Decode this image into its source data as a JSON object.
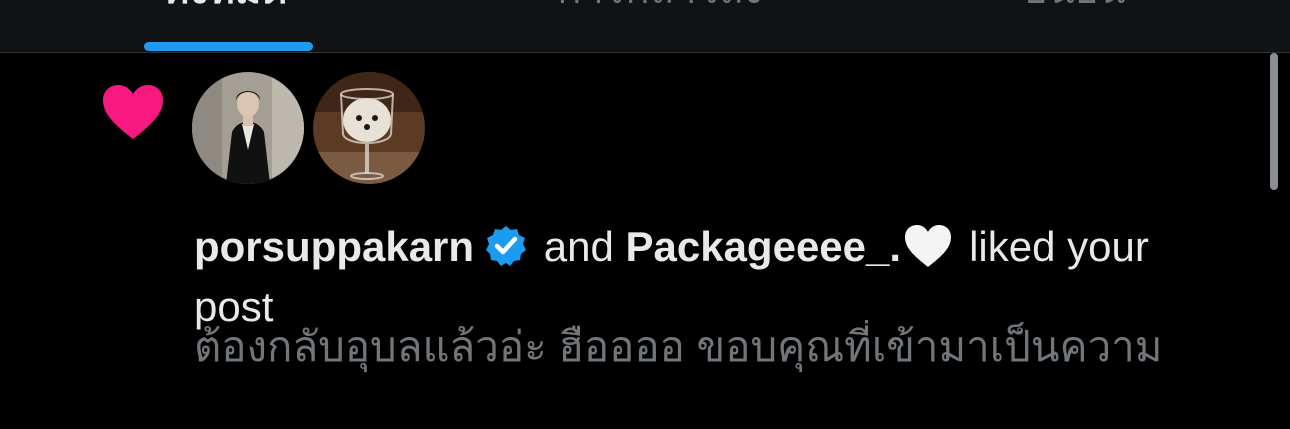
{
  "tabs": [
    {
      "label": "ทั้งหมด",
      "active": true
    },
    {
      "label": "การกล่าวถึง",
      "active": false
    },
    {
      "label": "ยืนยัน",
      "active": false
    }
  ],
  "notification": {
    "type_icon": "heart-icon",
    "type_color": "#f91880",
    "avatars": [
      {
        "user": "porsuppakarn",
        "icon": "avatar-person-in-suit"
      },
      {
        "user": "Packageeee_.",
        "icon": "avatar-dog-in-wine-glass"
      }
    ],
    "actor_1": "porsuppakarn",
    "verified_icon": "verified-badge-icon",
    "verified_color": "#1d9bf0",
    "connector": "and",
    "actor_2": "Packageeee_.",
    "actor_2_emoji": "white-heart-icon",
    "action_line_1": "liked your",
    "action_line_2": "post",
    "post_preview": "ต้องกลับอุบลแล้วอ่ะ ฮืออออ ขอบคุณที่เข้ามาเป็นความ"
  },
  "accent_color": "#1d9bf0"
}
